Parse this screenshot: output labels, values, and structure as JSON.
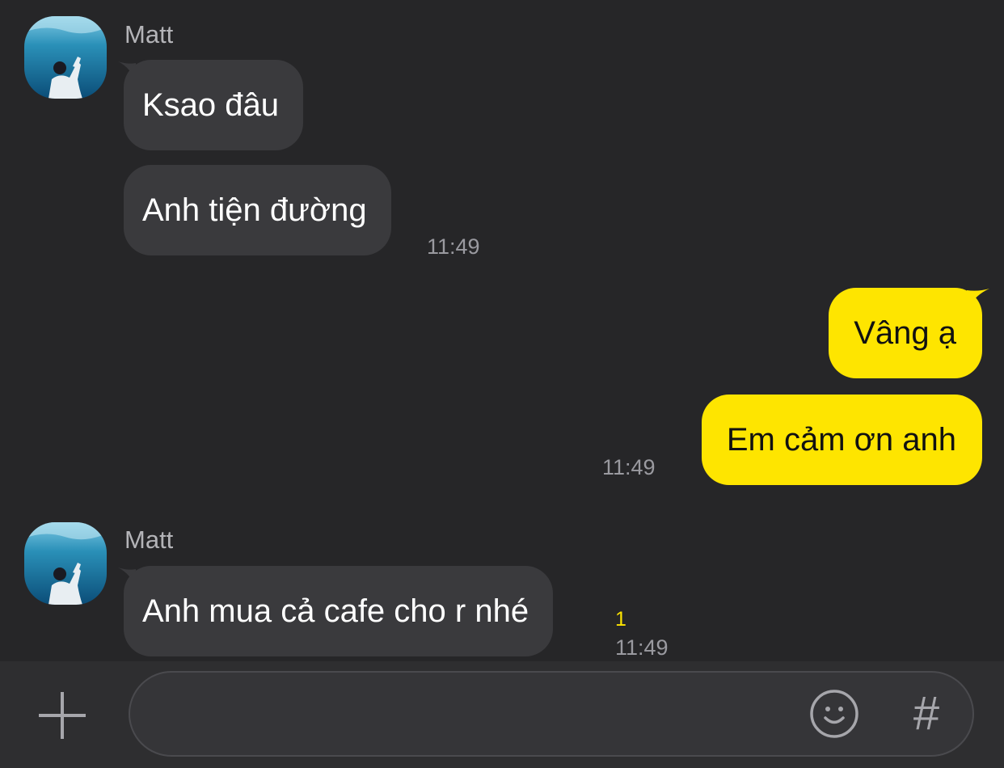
{
  "messages": [
    {
      "sender": "Matt",
      "bubbles": [
        "Ksao đâu",
        "Anh tiện đường"
      ],
      "time": "11:49"
    },
    {
      "bubbles": [
        "Vâng ạ",
        "Em cảm ơn anh"
      ],
      "time": "11:49"
    },
    {
      "sender": "Matt",
      "bubbles": [
        "Anh mua cả cafe cho r nhé"
      ],
      "unread": "1",
      "time": "11:49"
    }
  ],
  "composer": {
    "value": "",
    "placeholder": "",
    "plus_icon": "plus-icon",
    "emoji_icon": "emoji-icon",
    "hash_icon": "hashtag-icon",
    "hash_label": "#"
  },
  "colors": {
    "background": "#262628",
    "incoming_bubble": "#3a3a3d",
    "outgoing_bubble": "#fee500",
    "unread": "#fee500"
  }
}
